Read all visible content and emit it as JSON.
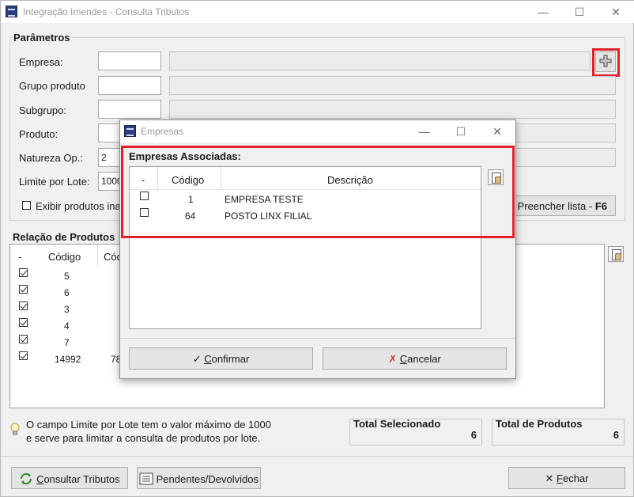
{
  "window": {
    "title": "Integração Imendes - Consulta Tributos",
    "minimize": "—",
    "maximize": "☐",
    "close": "✕"
  },
  "parametros": {
    "title": "Parâmetros",
    "empresa_label": "Empresa:",
    "grupo_label": "Grupo produto",
    "subgrupo_label": "Subgrupo:",
    "produto_label": "Produto:",
    "natureza_label": "Natureza Op.:",
    "natureza_value": "2",
    "limite_label": "Limite por Lote:",
    "limite_value": "1000",
    "exibir_label": "Exibir produtos ina",
    "preencher_label": "Preencher lista - ",
    "preencher_key": "F6"
  },
  "produtos": {
    "title": "Relação de Produtos",
    "col_dash": "-",
    "col_codigo": "Código",
    "col_cod2": "Cód",
    "rows": [
      {
        "codigo": "5",
        "extra": "",
        "checked": true
      },
      {
        "codigo": "6",
        "extra": "",
        "checked": true
      },
      {
        "codigo": "3",
        "extra": "",
        "checked": true
      },
      {
        "codigo": "4",
        "extra": "",
        "checked": true
      },
      {
        "codigo": "7",
        "extra": "",
        "checked": true
      },
      {
        "codigo": "14992",
        "extra": "78",
        "checked": true
      }
    ]
  },
  "info": {
    "line1": "O campo Limite por Lote tem o valor máximo de 1000",
    "line2": "e serve para limitar a consulta de produtos por lote."
  },
  "totals": {
    "selecionado_label": "Total Selecionado",
    "selecionado_value": "6",
    "produtos_label": "Total de Produtos",
    "produtos_value": "6"
  },
  "footer": {
    "consultar_first": "C",
    "consultar_rest": "onsultar Tributos",
    "pendentes": "Pendentes/Devolvidos",
    "fechar_first": "F",
    "fechar_rest": "echar"
  },
  "dialog": {
    "title": "Empresas",
    "section": "Empresas Associadas:",
    "col_dash": "-",
    "col_codigo": "Código",
    "col_descricao": "Descrição",
    "rows": [
      {
        "codigo": "1",
        "descricao": "EMPRESA TESTE"
      },
      {
        "codigo": "64",
        "descricao": "POSTO LINX FILIAL"
      }
    ],
    "confirmar_first": "C",
    "confirmar_rest": "onfirmar",
    "cancelar_first": "C",
    "cancelar_rest": "ancelar"
  },
  "colors": {
    "highlight": "#e2202a",
    "titlebar_text": "#9a9a9a"
  }
}
